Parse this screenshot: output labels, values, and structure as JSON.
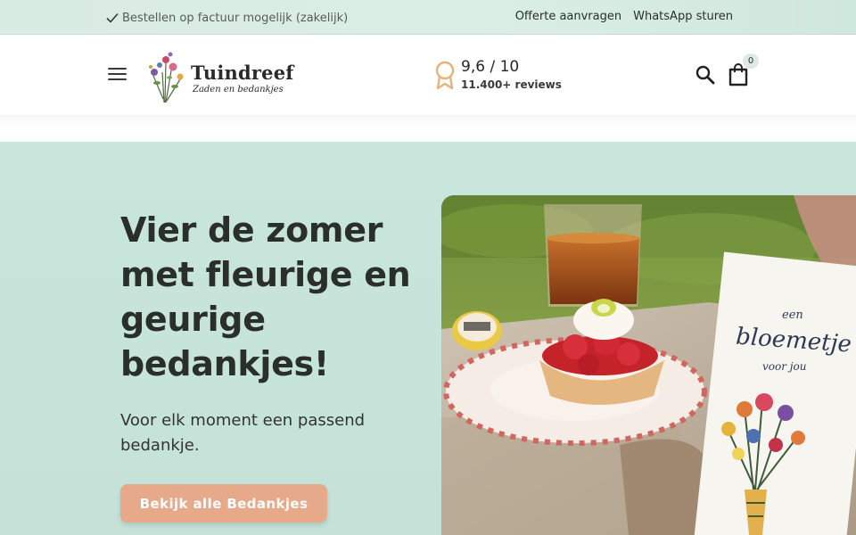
{
  "topbar": {
    "usp_text": "Bestellen op factuur mogelijk (zakelijk)",
    "links": [
      "Offerte aanvragen",
      "WhatsApp sturen"
    ]
  },
  "header": {
    "menu_icon": "hamburger-menu-icon",
    "logo": {
      "brand": "Tuindreef",
      "tagline": "Zaden en bedankjes"
    },
    "rating": {
      "score": "9,6 / 10",
      "reviews": "11.400+ reviews",
      "icon": "award-ribbon-icon"
    },
    "search_icon": "search-icon",
    "cart": {
      "icon": "shopping-bag-icon",
      "count": "0"
    }
  },
  "hero": {
    "title": "Vier de zomer met fleurige en geurige bedankjes!",
    "subtitle": "Voor elk moment een passend bedankje.",
    "cta_label": "Bekijk alle Bedankjes",
    "image_card_text": [
      "een",
      "bloemetje",
      "voor jou"
    ]
  },
  "colors": {
    "topbar_bg": "#d9ece3",
    "hero_bg": "#c9e6dc",
    "cta_bg": "#e6a98a",
    "rating_icon": "#e8b27a"
  }
}
